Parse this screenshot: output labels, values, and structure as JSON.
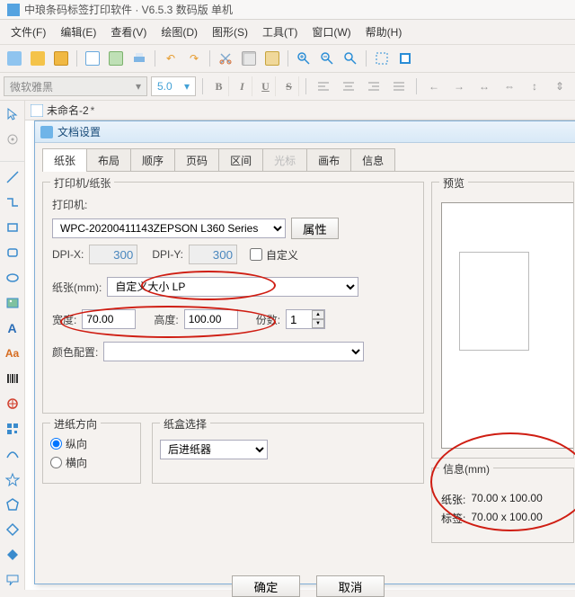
{
  "app_title": "中琅条码标签打印软件 · V6.5.3 数码版 单机",
  "menus": [
    "文件(F)",
    "编辑(E)",
    "查看(V)",
    "绘图(D)",
    "图形(S)",
    "工具(T)",
    "窗口(W)",
    "帮助(H)"
  ],
  "fontbar": {
    "font_name_placeholder": "微软雅黑",
    "font_size": "5.0"
  },
  "format_btns": {
    "bold": "B",
    "italic": "I",
    "underline": "U",
    "strike": "S"
  },
  "doc_tab": {
    "label": "未命名-2",
    "dirty_mark": "*"
  },
  "dialog": {
    "title": "文档设置",
    "tabs": [
      "纸张",
      "布局",
      "顺序",
      "页码",
      "区间",
      "光标",
      "画布",
      "信息"
    ],
    "active_tab_index": 0,
    "group_printer_legend": "打印机/纸张",
    "lbl_printer": "打印机:",
    "printer_value": "WPC-20200411143ZEPSON L360 Series",
    "btn_properties": "属性",
    "lbl_dpix": "DPI-X:",
    "dpix_value": "300",
    "lbl_dpiy": "DPI-Y:",
    "dpiy_value": "300",
    "chk_custom_dpi": "自定义",
    "lbl_paper": "纸张(mm):",
    "paper_value": "自定义大小 LP",
    "lbl_width": "宽度:",
    "width_value": "70.00",
    "lbl_height": "高度:",
    "height_value": "100.00",
    "lbl_copies": "份数:",
    "copies_value": "1",
    "lbl_color": "颜色配置:",
    "group_feed_legend": "进纸方向",
    "radio_portrait": "纵向",
    "radio_landscape": "横向",
    "group_tray_legend": "纸盒选择",
    "tray_value": "后进纸器",
    "preview_legend": "预览",
    "info_legend": "信息(mm)",
    "info_paper_lbl": "纸张:",
    "info_paper_val": "70.00 x 100.00",
    "info_label_lbl": "标签:",
    "info_label_val": "70.00 x 100.00",
    "btn_ok": "确定",
    "btn_cancel": "取消"
  }
}
